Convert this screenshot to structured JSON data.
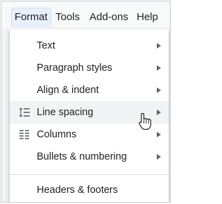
{
  "menubar": {
    "items": [
      {
        "label": "Format",
        "active": true
      },
      {
        "label": "Tools"
      },
      {
        "label": "Add-ons"
      },
      {
        "label": "Help"
      }
    ]
  },
  "format_menu": {
    "items": [
      {
        "label": "Text",
        "has_submenu": true
      },
      {
        "label": "Paragraph styles",
        "has_submenu": true
      },
      {
        "label": "Align & indent",
        "has_submenu": true
      },
      {
        "label": "Line spacing",
        "icon": "line-spacing-icon",
        "has_submenu": true,
        "hovered": true
      },
      {
        "label": "Columns",
        "icon": "columns-icon",
        "has_submenu": true
      },
      {
        "label": "Bullets & numbering",
        "has_submenu": true
      },
      {
        "label": "Headers & footers"
      }
    ]
  },
  "colors": {
    "menubar_bg": "#f8f9fa",
    "active_menu_bg": "#e8f0fe",
    "hover_row_bg": "#f1f3f4",
    "text": "#202124",
    "icon": "#5f6368"
  },
  "cursor": {
    "icon": "hand-pointer-cursor"
  }
}
